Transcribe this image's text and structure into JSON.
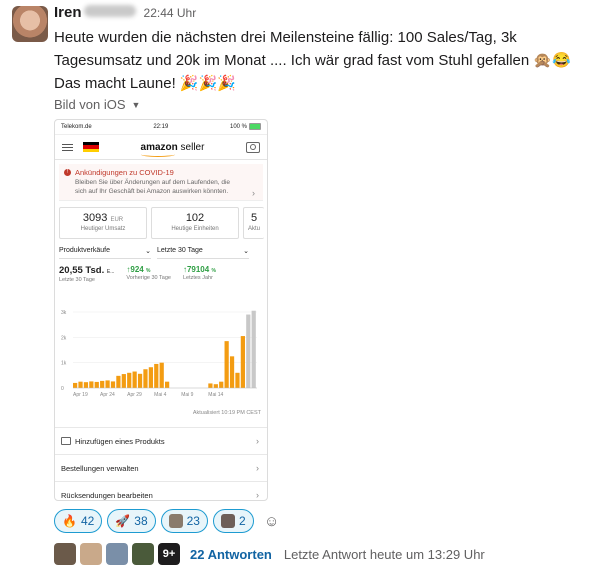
{
  "message": {
    "author": "Iren",
    "time": "22:44 Uhr",
    "text_line1": "Heute wurden die nächsten drei Meilensteine fällig: 100 Sales/Tag, 3k",
    "text_line2": "Tagesumsatz und 20k im Monat .... Ich wär grad fast vom Stuhl gefallen",
    "text_line3": "Das macht Laune!",
    "emoji_monkey": "🙊",
    "emoji_laugh": "😂",
    "emoji_party": "🎉🎉🎉",
    "attachment_label": "Bild von iOS"
  },
  "screenshot": {
    "status": {
      "carrier": "Telekom.de",
      "time": "22:19",
      "battery": "100 %"
    },
    "brand": {
      "bold": "amazon",
      "light": " seller"
    },
    "announcement": {
      "title": "Ankündigungen zu COVID-19",
      "body": "Bleiben Sie über Änderungen auf dem Laufenden, die sich auf Ihr Geschäft bei Amazon auswirken könnten."
    },
    "cards": [
      {
        "value": "3093",
        "unit": "EUR",
        "label": "Heutiger Umsatz"
      },
      {
        "value": "102",
        "unit": "",
        "label": "Heutige Einheiten"
      },
      {
        "value": "5",
        "unit": "",
        "label": "Aktu"
      }
    ],
    "dropdowns": {
      "left": "Produktverkäufe",
      "right": "Letzte 30 Tage"
    },
    "stats": [
      {
        "value": "20,55 Tsd.",
        "suffix": "E...",
        "label": "Letzte 30 Tage"
      },
      {
        "value": "↑924",
        "suffix": "%",
        "label": "Vorherige 30 Tage"
      },
      {
        "value": "↑79104",
        "suffix": "%",
        "label": "Letztes Jahr"
      }
    ],
    "updated": "Aktualisiert 10:19 PM CEST",
    "list": [
      "Hinzufügen eines Produkts",
      "Bestellungen verwalten",
      "Rücksendungen bearbeiten"
    ]
  },
  "chart_data": {
    "type": "bar",
    "yticks": [
      "0",
      "1k",
      "2k",
      "3k"
    ],
    "ylim": [
      0,
      3000
    ],
    "xticks": [
      "Apr 19",
      "Apr 24",
      "Apr 29",
      "Mai 4",
      "Mai 9",
      "Mai 14"
    ],
    "values": [
      200,
      250,
      230,
      260,
      240,
      280,
      300,
      260,
      480,
      550,
      600,
      650,
      560,
      740,
      820,
      950,
      1000,
      250,
      0,
      0,
      0,
      0,
      0,
      0,
      0,
      180,
      150,
      250,
      1850,
      1250,
      600,
      2050,
      2900,
      3050
    ],
    "highlight_index": [
      32,
      33
    ],
    "colors": {
      "bar": "#f39c12",
      "today": "#c8c8c8"
    }
  },
  "reactions": [
    {
      "icon": "🔥",
      "count": "42",
      "name": "fire"
    },
    {
      "icon": "🚀",
      "count": "38",
      "name": "rocket"
    },
    {
      "icon": "",
      "count": "23",
      "name": "custom-face"
    },
    {
      "icon": "",
      "count": "2",
      "name": "custom-face-2"
    }
  ],
  "thread": {
    "replies": "22 Antworten",
    "last_reply": "Letzte Antwort heute um 13:29 Uhr",
    "more": "9+"
  }
}
